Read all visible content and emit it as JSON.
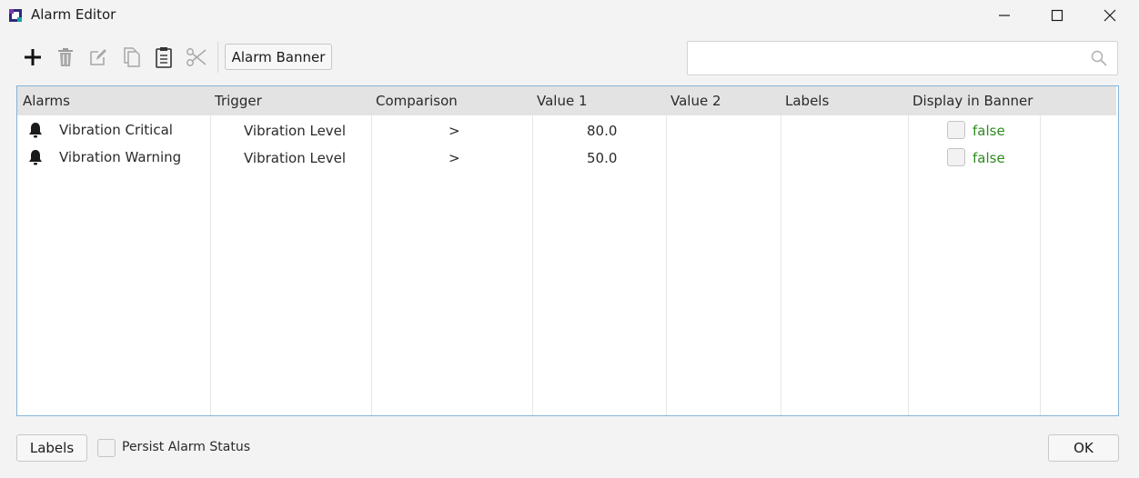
{
  "window": {
    "title": "Alarm Editor",
    "minimize_icon": "minimize-icon",
    "maximize_icon": "maximize-icon",
    "close_icon": "close-icon"
  },
  "toolbar": {
    "tools": [
      "add-icon",
      "delete-icon",
      "edit-icon",
      "copy-icon",
      "paste-icon",
      "cut-icon"
    ],
    "alarm_banner_label": "Alarm Banner"
  },
  "search": {
    "placeholder": "",
    "value": "",
    "icon": "search-icon"
  },
  "table": {
    "headers": [
      "Alarms",
      "Trigger",
      "Comparison",
      "Value 1",
      "Value 2",
      "Labels",
      "Display in Banner"
    ],
    "rows": [
      {
        "icon": "bell-icon",
        "name": "Vibration Critical",
        "trigger": "Vibration Level",
        "comparison": ">",
        "value1": "80.0",
        "value2": "",
        "labels": "",
        "display_in_banner": "false"
      },
      {
        "icon": "bell-icon",
        "name": "Vibration Warning",
        "trigger": "Vibration Level",
        "comparison": ">",
        "value1": "50.0",
        "value2": "",
        "labels": "",
        "display_in_banner": "false"
      }
    ]
  },
  "footer": {
    "labels_button": "Labels",
    "persist_label": "Persist Alarm Status",
    "ok_button": "OK"
  },
  "colors": {
    "true_false_text": "#2e8b1e",
    "table_border": "#86b4d8",
    "header_bg": "#e3e3e3"
  }
}
